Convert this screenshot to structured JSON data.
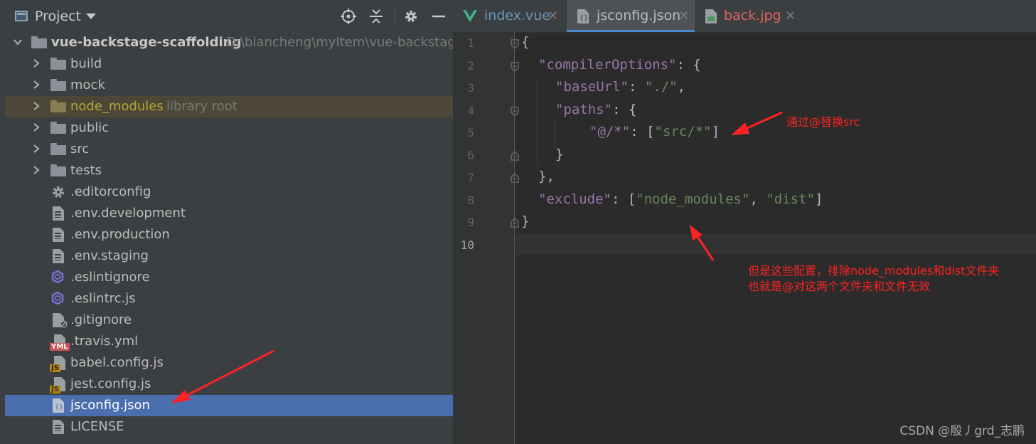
{
  "project_panel": {
    "title": "Project",
    "root": {
      "name": "vue-backstage-scaffolding",
      "path": "D:\\biancheng\\myItem\\vue-backstage"
    },
    "folders": [
      {
        "name": "build"
      },
      {
        "name": "mock"
      },
      {
        "name": "node_modules",
        "hint": "library root"
      },
      {
        "name": "public"
      },
      {
        "name": "src"
      },
      {
        "name": "tests"
      }
    ],
    "files": [
      {
        "name": ".editorconfig",
        "icon": "gear-icon"
      },
      {
        "name": ".env.development",
        "icon": "text-file-icon"
      },
      {
        "name": ".env.production",
        "icon": "text-file-icon"
      },
      {
        "name": ".env.staging",
        "icon": "text-file-icon"
      },
      {
        "name": ".eslintignore",
        "icon": "eslint-icon"
      },
      {
        "name": ".eslintrc.js",
        "icon": "eslint-icon"
      },
      {
        "name": ".gitignore",
        "icon": "gitignore-icon"
      },
      {
        "name": ".travis.yml",
        "icon": "yml-file-icon",
        "badge": "YML"
      },
      {
        "name": "babel.config.js",
        "icon": "js-file-icon",
        "badge": "JS"
      },
      {
        "name": "jest.config.js",
        "icon": "js-file-icon",
        "badge": "JS"
      },
      {
        "name": "jsconfig.json",
        "icon": "json-file-icon",
        "selected": true
      },
      {
        "name": "LICENSE",
        "icon": "text-file-icon"
      }
    ]
  },
  "tabs": [
    {
      "label": "index.vue",
      "icon": "vue-icon",
      "color": "#6897bb"
    },
    {
      "label": "jsconfig.json",
      "icon": "json-file-icon",
      "color": "#bbbbbb",
      "active": true
    },
    {
      "label": "back.jpg",
      "icon": "image-file-icon",
      "color": "#e0645c"
    }
  ],
  "editor": {
    "line_numbers": [
      "1",
      "2",
      "3",
      "4",
      "5",
      "6",
      "7",
      "8",
      "9",
      "10"
    ],
    "current_line": "10",
    "code": {
      "l1_brace": "{",
      "l2_key": "\"compilerOptions\"",
      "l2_rest": ": {",
      "l3_key": "\"baseUrl\"",
      "l3_colon": ": ",
      "l3_value": "\"./\"",
      "l3_comma": ",",
      "l4_key": "\"paths\"",
      "l4_rest": ": {",
      "l5_key": "\"@/*\"",
      "l5_colon": ": [",
      "l5_value": "\"src/*\"",
      "l5_close": "]",
      "l6_brace": "}",
      "l7_brace": "},",
      "l8_key": "\"exclude\"",
      "l8_colon": ": [",
      "l8_v1": "\"node_modules\"",
      "l8_comma": ", ",
      "l8_v2": "\"dist\"",
      "l8_close": "]",
      "l9_brace": "}"
    }
  },
  "annotations": {
    "note1": "通过@替换src",
    "note2_line1": "但是这些配置，排除node_modules和dist文件夹",
    "note2_line2": "也就是@对这两个文件夹和文件无效",
    "color": "#ff2222"
  },
  "watermark": "CSDN @殷丿grd_志鹏",
  "colors": {
    "panel_bg": "#3c3f41",
    "editor_bg": "#2b2b2b",
    "selection": "#4b6eaf",
    "library_row": "#4c4737",
    "key": "#9876aa",
    "string": "#6a8759",
    "punct": "#a9b7c6"
  }
}
